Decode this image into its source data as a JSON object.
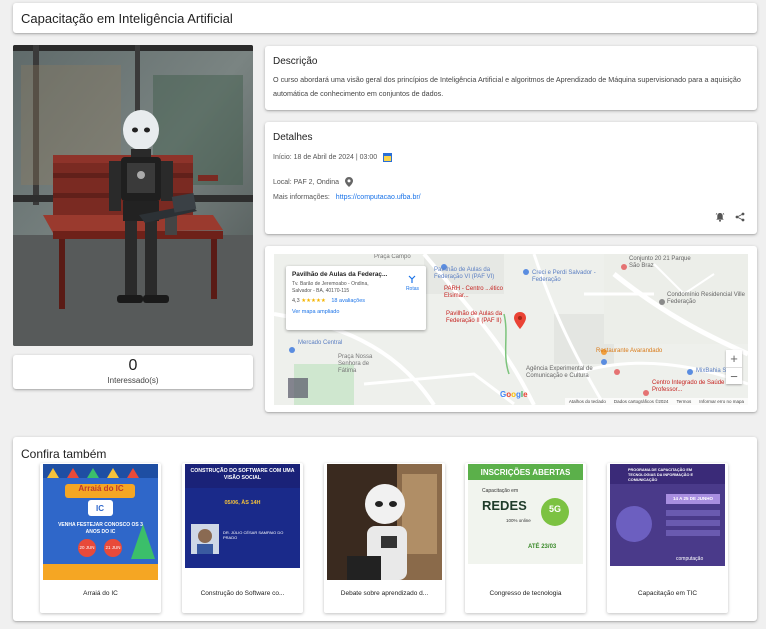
{
  "page": {
    "title": "Capacitação em Inteligência Artificial"
  },
  "interest": {
    "count": "0",
    "label": "Interessado(s)"
  },
  "description": {
    "heading": "Descrição",
    "text": "O curso abordará uma visão geral dos princípios de Inteligência Artificial e algoritmos de Aprendizado de Máquina supervisionado para a aquisição automática de conhecimento em conjuntos de dados."
  },
  "details": {
    "heading": "Detalhes",
    "start": "Início: 18 de Abril de 2024 | 03:00",
    "location": "Local: PAF 2, Ondina",
    "more_label": "Mais informações:",
    "more_link": "https://computacao.ufba.br/"
  },
  "map": {
    "place_name": "Pavilhão de Aulas da Federaç...",
    "place_address": "Tv. Barão de Jeremoabo - Ondina, Salvador - BA, 40170-115",
    "rating": "4,3",
    "stars": "★★★★★",
    "reviews": "18 avaliações",
    "enlarge": "Ver mapa ampliado",
    "routes": "Rotas",
    "labels": {
      "pavilhao_vi": "Pavilhão de Aulas da Federação VI (PAF VI)",
      "creci": "Creci e Perdi Salvador - Federação",
      "conjunto": "Conjunto 20 21 Parque São Braz",
      "condominio": "Condomínio Residencial Ville Federação",
      "pavilhao_ii": "Pavilhão de Aulas da Federação II (PAF II)",
      "parh": "PARH - Centro ...ético Elsimar...",
      "mercado": "Mercado Central",
      "praca": "Praça Nossa Senhora de Fátima",
      "restaurante": "Restaurante Avarandado",
      "agencia": "Agência Experimental de Comunicação e Cultura",
      "centro": "Centro Integrado de Saúde Professor...",
      "mixbahia": "MixBahia S...",
      "street_fed": "R. Caetano Moura",
      "street_arg": "R. Barão de Jeremoabo",
      "street_ademar": "Av. Cardeal da Silva",
      "street_apolo": "R. Apolinário",
      "street_campo": "Praça Campo",
      "street_nossa": "R. Augusto Viana"
    },
    "google": "Google",
    "footer": [
      "Atalhos do teclado",
      "Dados cartográficos ©2024",
      "Termos",
      "Informar erro no mapa"
    ],
    "zoom_in": "+",
    "zoom_out": "−"
  },
  "related": {
    "heading": "Confira também",
    "items": [
      {
        "label": "Arraiá do IC",
        "poster_title": "Arraiá do IC",
        "poster_sub": "VENHA FESTEJAR CONOSCO OS 3 ANOS DO IC",
        "poster_date": "20 JUN",
        "poster_date2": "21 JUN"
      },
      {
        "label": "Construção do Software co...",
        "poster_title": "CONSTRUÇÃO DO SOFTWARE COM UMA VISÃO SOCIAL",
        "poster_sub": "05/06, ÀS 14H",
        "poster_speaker": "DR. JÚLIO CÉSAR SAMPAIO DO PRADO"
      },
      {
        "label": "Debate sobre aprendizado d..."
      },
      {
        "label": "Congresso de tecnologia",
        "poster_title": "INSCRIÇÕES ABERTAS",
        "poster_sub": "Capacitação em",
        "poster_big": "REDES",
        "poster_badge": "5G",
        "poster_note": "100% online",
        "poster_date": "ATÉ 23/03"
      },
      {
        "label": "Capacitação em TIC",
        "poster_title": "PROGRAMA DE CAPACITAÇÃO EM TECNOLOGIAS DA INFORMAÇÃO E COMUNICAÇÃO",
        "poster_date": "14 A 25 DE JUNHO",
        "poster_brand": "computação"
      }
    ]
  },
  "colors": {
    "link": "#1a73e8",
    "pin": "#ea4335"
  }
}
